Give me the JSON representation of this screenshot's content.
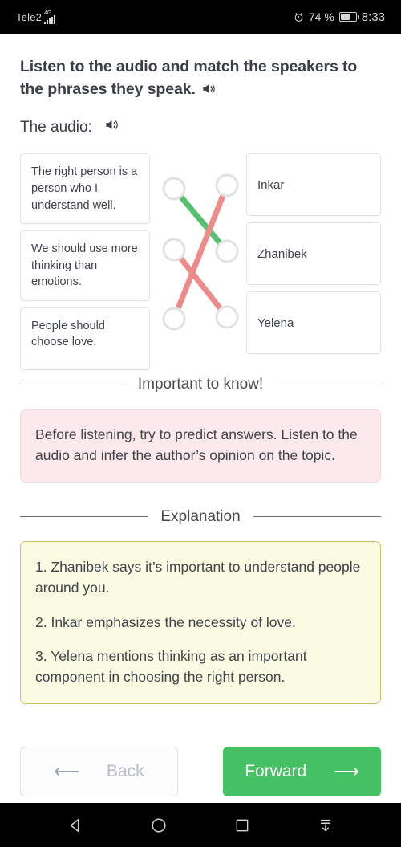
{
  "status_bar": {
    "carrier": "Tele2",
    "network": "4G",
    "signal_icon": "signal-bars-icon",
    "alarm_icon": "alarm-clock-icon",
    "battery_percent": "74 %",
    "battery_icon": "battery-icon",
    "time": "8:33"
  },
  "task": {
    "instruction": "Listen to the audio and match the speakers to the phrases they speak.",
    "instruction_speaker_icon": "speaker-icon",
    "audio_label": "The audio:",
    "audio_speaker_icon": "speaker-icon"
  },
  "match": {
    "phrases": [
      "The right person is a person who I understand well.",
      "We should use more thinking than emotions.",
      "People should choose love."
    ],
    "speakers": [
      "Inkar",
      "Zhanibek",
      "Yelena"
    ],
    "connections": [
      {
        "from": 0,
        "to": 1,
        "color": "#56c271"
      },
      {
        "from": 1,
        "to": 2,
        "color": "#ef8a8a"
      },
      {
        "from": 2,
        "to": 0,
        "color": "#ef8a8a"
      }
    ]
  },
  "important": {
    "heading": "Important to know!",
    "body": "Before listening, try to predict answers. Listen to the audio and infer the author’s opinion on the topic.",
    "background_color": "#fbe9ec"
  },
  "explanation": {
    "heading": "Explanation",
    "items": [
      "1. Zhanibek says it’s important to understand people around you.",
      "2. Inkar emphasizes the necessity of love.",
      "3. Yelena mentions thinking as an important component in choosing the right person."
    ],
    "background_color": "#fbfae3",
    "border_color": "#ccbf6d"
  },
  "footer": {
    "back_label": "Back",
    "back_icon": "arrow-left-icon",
    "forward_label": "Forward",
    "forward_icon": "arrow-right-icon",
    "forward_color": "#45c163"
  },
  "navbar": {
    "back_icon": "triangle-back-icon",
    "home_icon": "circle-home-icon",
    "recents_icon": "square-recents-icon",
    "hide_icon": "hide-navbar-icon"
  }
}
